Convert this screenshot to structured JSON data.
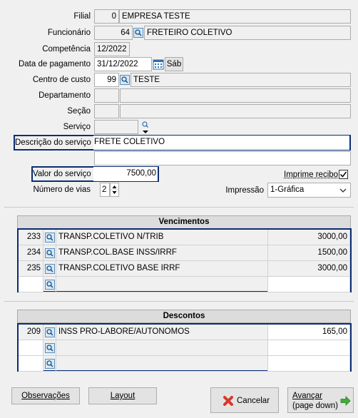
{
  "form": {
    "filial_label": "Filial",
    "filial_code": "0",
    "filial_name": "EMPRESA TESTE",
    "funcionario_label": "Funcionário",
    "funcionario_code": "64",
    "funcionario_name": "FRETEIRO COLETIVO",
    "competencia_label": "Competência",
    "competencia_value": "12/2022",
    "data_pagamento_label": "Data de pagamento",
    "data_pagamento_value": "31/12/2022",
    "data_pagamento_weekday": "Sáb",
    "centro_custo_label": "Centro de custo",
    "centro_custo_code": "99",
    "centro_custo_name": "TESTE",
    "departamento_label": "Departamento",
    "secao_label": "Seção",
    "servico_label": "Serviço",
    "descricao_label": "Descrição do serviço",
    "descricao_value": "FRETE COLETIVO",
    "valor_label": "Valor do serviço",
    "valor_value": "7500,00",
    "imprime_recibo_label": "Imprime recibo",
    "numero_vias_label": "Número de vias",
    "numero_vias_value": "2",
    "impressao_label": "Impressão",
    "impressao_value": "1-Gráfica"
  },
  "vencimentos": {
    "title": "Vencimentos",
    "rows": [
      {
        "code": "233",
        "desc": "TRANSP.COLETIVO N/TRIB",
        "value": "3000,00"
      },
      {
        "code": "234",
        "desc": "TRANSP.COL.BASE INSS/IRRF",
        "value": "1500,00"
      },
      {
        "code": "235",
        "desc": "TRANSP.COLETIVO BASE IRRF",
        "value": "3000,00"
      },
      {
        "code": "",
        "desc": "",
        "value": ""
      }
    ]
  },
  "descontos": {
    "title": "Descontos",
    "rows": [
      {
        "code": "209",
        "desc": "INSS PRO-LABORE/AUTONOMOS",
        "value": "165,00"
      },
      {
        "code": "",
        "desc": "",
        "value": ""
      },
      {
        "code": "",
        "desc": "",
        "value": ""
      }
    ]
  },
  "buttons": {
    "observacoes": "Observações",
    "layout": "Layout",
    "cancelar": "Cancelar",
    "avancar_line1": "Avançar",
    "avancar_line2": "(page down)"
  },
  "colors": {
    "highlight_border": "#0a2d73",
    "window_bg": "#f0f0f0",
    "cancel_icon": "#d9362b",
    "next_icon": "#3fae3a"
  }
}
